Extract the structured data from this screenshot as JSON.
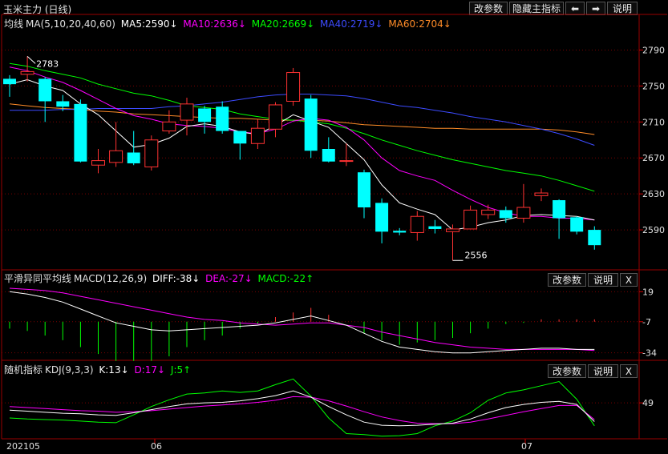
{
  "toolbar": {
    "title": "玉米主力 (日线)",
    "btn_params": "改参数",
    "btn_hide": "隐藏主指标",
    "btn_prev": "⬅",
    "btn_next": "➡",
    "btn_help": "说明"
  },
  "panel_ma": {
    "name": "均线",
    "params": "MA(5,10,20,40,60)",
    "ma5": "MA5:2590↓",
    "ma10": "MA10:2636↓",
    "ma20": "MA20:2669↓",
    "ma40": "MA40:2719↓",
    "ma60": "MA60:2704↓"
  },
  "panel_macd": {
    "name": "平滑异同平均线",
    "params": "MACD(12,26,9)",
    "diff": "DIFF:-38↓",
    "dea": "DEA:-27↓",
    "macd": "MACD:-22↑",
    "btn_params": "改参数",
    "btn_help": "说明",
    "btn_close": "X"
  },
  "panel_kdj": {
    "name": "随机指标",
    "params": "KDJ(9,3,3)",
    "k": "K:13↓",
    "d": "D:17↓",
    "j": "J:5↑",
    "btn_params": "改参数",
    "btn_help": "说明",
    "btn_close": "X"
  },
  "colors": {
    "up": "#ff3232",
    "down": "#00ffff",
    "ma5": "#ffffff",
    "ma10": "#ff00ff",
    "ma20": "#00ff00",
    "ma40": "#3c4bff",
    "ma60": "#ff8c28",
    "grid": "#7a0000"
  },
  "chart_data": [
    {
      "type": "candlestick",
      "title": "玉米主力 (日线)",
      "ylim": [
        2550,
        2810
      ],
      "y_ticks": [
        2790,
        2750,
        2710,
        2670,
        2630,
        2590
      ],
      "x_labels": [
        "202105",
        "06",
        "07"
      ],
      "annotations": [
        {
          "text": "2783",
          "value": 2783
        },
        {
          "text": "2556",
          "value": 2556
        }
      ],
      "candles": [
        {
          "o": 2758,
          "c": 2752,
          "h": 2762,
          "l": 2738
        },
        {
          "o": 2763,
          "c": 2766,
          "h": 2783,
          "l": 2755
        },
        {
          "o": 2758,
          "c": 2733,
          "h": 2760,
          "l": 2710
        },
        {
          "o": 2733,
          "c": 2727,
          "h": 2740,
          "l": 2722
        },
        {
          "o": 2730,
          "c": 2666,
          "h": 2735,
          "l": 2665
        },
        {
          "o": 2662,
          "c": 2667,
          "h": 2680,
          "l": 2653
        },
        {
          "o": 2665,
          "c": 2678,
          "h": 2710,
          "l": 2660
        },
        {
          "o": 2676,
          "c": 2664,
          "h": 2700,
          "l": 2662
        },
        {
          "o": 2660,
          "c": 2690,
          "h": 2695,
          "l": 2656
        },
        {
          "o": 2700,
          "c": 2710,
          "h": 2723,
          "l": 2697
        },
        {
          "o": 2712,
          "c": 2730,
          "h": 2737,
          "l": 2695
        },
        {
          "o": 2725,
          "c": 2710,
          "h": 2728,
          "l": 2697
        },
        {
          "o": 2727,
          "c": 2700,
          "h": 2733,
          "l": 2697
        },
        {
          "o": 2700,
          "c": 2686,
          "h": 2700,
          "l": 2668
        },
        {
          "o": 2686,
          "c": 2703,
          "h": 2713,
          "l": 2680
        },
        {
          "o": 2702,
          "c": 2729,
          "h": 2732,
          "l": 2693
        },
        {
          "o": 2733,
          "c": 2765,
          "h": 2770,
          "l": 2728
        },
        {
          "o": 2736,
          "c": 2678,
          "h": 2740,
          "l": 2670
        },
        {
          "o": 2680,
          "c": 2666,
          "h": 2693,
          "l": 2665
        },
        {
          "o": 2667,
          "c": 2667,
          "h": 2686,
          "l": 2661
        },
        {
          "o": 2654,
          "c": 2615,
          "h": 2657,
          "l": 2603
        },
        {
          "o": 2620,
          "c": 2588,
          "h": 2625,
          "l": 2575
        },
        {
          "o": 2589,
          "c": 2587,
          "h": 2592,
          "l": 2584
        },
        {
          "o": 2587,
          "c": 2605,
          "h": 2611,
          "l": 2578
        },
        {
          "o": 2594,
          "c": 2591,
          "h": 2601,
          "l": 2586
        },
        {
          "o": 2588,
          "c": 2591,
          "h": 2596,
          "l": 2556
        },
        {
          "o": 2591,
          "c": 2612,
          "h": 2617,
          "l": 2591
        },
        {
          "o": 2607,
          "c": 2612,
          "h": 2618,
          "l": 2602
        },
        {
          "o": 2612,
          "c": 2603,
          "h": 2616,
          "l": 2598
        },
        {
          "o": 2603,
          "c": 2615,
          "h": 2641,
          "l": 2598
        },
        {
          "o": 2628,
          "c": 2631,
          "h": 2636,
          "l": 2622
        },
        {
          "o": 2623,
          "c": 2603,
          "h": 2624,
          "l": 2580
        },
        {
          "o": 2604,
          "c": 2588,
          "h": 2605,
          "l": 2585
        },
        {
          "o": 2590,
          "c": 2573,
          "h": 2594,
          "l": 2568
        }
      ],
      "ma5": [
        2752,
        2757,
        2750,
        2745,
        2730,
        2718,
        2700,
        2682,
        2685,
        2692,
        2705,
        2708,
        2705,
        2699,
        2696,
        2706,
        2718,
        2711,
        2704,
        2686,
        2668,
        2640,
        2620,
        2613,
        2607,
        2590,
        2593,
        2598,
        2601,
        2606,
        2607,
        2606,
        2605,
        2601
      ],
      "ma10": [
        2771,
        2767,
        2760,
        2754,
        2745,
        2735,
        2725,
        2717,
        2713,
        2708,
        2706,
        2705,
        2703,
        2699,
        2697,
        2702,
        2711,
        2714,
        2712,
        2704,
        2690,
        2670,
        2656,
        2650,
        2645,
        2634,
        2624,
        2615,
        2609,
        2605,
        2605,
        2603,
        2603,
        2601
      ],
      "ma20": [
        2775,
        2772,
        2767,
        2763,
        2759,
        2752,
        2747,
        2742,
        2739,
        2734,
        2728,
        2726,
        2724,
        2719,
        2716,
        2713,
        2712,
        2710,
        2708,
        2703,
        2697,
        2690,
        2684,
        2678,
        2673,
        2668,
        2664,
        2660,
        2656,
        2653,
        2650,
        2645,
        2639,
        2633
      ],
      "ma40": [
        2723,
        2723,
        2723,
        2724,
        2724,
        2725,
        2725,
        2725,
        2725,
        2727,
        2728,
        2730,
        2732,
        2735,
        2738,
        2740,
        2741,
        2741,
        2740,
        2739,
        2736,
        2732,
        2728,
        2726,
        2723,
        2720,
        2716,
        2713,
        2710,
        2706,
        2702,
        2697,
        2691,
        2684
      ],
      "ma60": [
        2730,
        2728,
        2726,
        2725,
        2724,
        2722,
        2721,
        2719,
        2718,
        2717,
        2716,
        2715,
        2714,
        2714,
        2713,
        2712,
        2712,
        2712,
        2711,
        2709,
        2707,
        2706,
        2705,
        2704,
        2703,
        2703,
        2702,
        2702,
        2702,
        2702,
        2702,
        2701,
        2699,
        2696
      ]
    },
    {
      "type": "line",
      "title": "MACD(12,26,9)",
      "ylim": [
        -37,
        22
      ],
      "y_ticks": [
        19,
        -7,
        -34
      ],
      "series": [
        {
          "name": "DIFF",
          "values": [
            19,
            17,
            14,
            10,
            4,
            -2,
            -8,
            -11,
            -14,
            -15,
            -14,
            -13,
            -12,
            -11,
            -10,
            -8,
            -5,
            -2,
            -6,
            -10,
            -17,
            -24,
            -29,
            -31,
            -33,
            -34,
            -34,
            -33,
            -32,
            -31,
            -30,
            -30,
            -31,
            -31
          ]
        },
        {
          "name": "DEA",
          "values": [
            22,
            21,
            20,
            18,
            15,
            12,
            9,
            6,
            3,
            0,
            -3,
            -5,
            -6,
            -8,
            -9,
            -10,
            -9,
            -8,
            -8,
            -10,
            -12,
            -16,
            -19,
            -22,
            -25,
            -27,
            -29,
            -30,
            -31,
            -31,
            -31,
            -31,
            -31,
            -32
          ]
        },
        {
          "name": "MACD",
          "values": [
            -6,
            -8,
            -12,
            -16,
            -22,
            -28,
            -34,
            -34,
            -34,
            -30,
            -22,
            -16,
            -12,
            -6,
            -2,
            4,
            8,
            12,
            6,
            0,
            -10,
            -16,
            -20,
            -18,
            -16,
            -14,
            -10,
            -6,
            -2,
            -1,
            2,
            2,
            2,
            2
          ]
        }
      ]
    },
    {
      "type": "line",
      "title": "KDJ(9,3,3)",
      "y_ticks": [
        49
      ],
      "series": [
        {
          "name": "K",
          "values": [
            35,
            33,
            31,
            29,
            28,
            26,
            25,
            30,
            36,
            42,
            47,
            49,
            50,
            53,
            57,
            63,
            72,
            60,
            42,
            26,
            12,
            6,
            5,
            6,
            8,
            10,
            18,
            30,
            40,
            46,
            50,
            52,
            46,
            13
          ]
        },
        {
          "name": "D",
          "values": [
            42,
            40,
            38,
            36,
            34,
            33,
            31,
            32,
            34,
            37,
            40,
            43,
            45,
            47,
            50,
            54,
            61,
            60,
            53,
            43,
            32,
            22,
            15,
            10,
            9,
            9,
            12,
            18,
            25,
            32,
            38,
            44,
            44,
            17
          ]
        },
        {
          "name": "J",
          "values": [
            20,
            18,
            17,
            16,
            14,
            12,
            11,
            26,
            42,
            55,
            66,
            68,
            72,
            69,
            72,
            84,
            95,
            62,
            20,
            -10,
            -12,
            -15,
            -14,
            -10,
            5,
            14,
            30,
            54,
            68,
            74,
            82,
            90,
            56,
            5
          ]
        }
      ]
    }
  ]
}
